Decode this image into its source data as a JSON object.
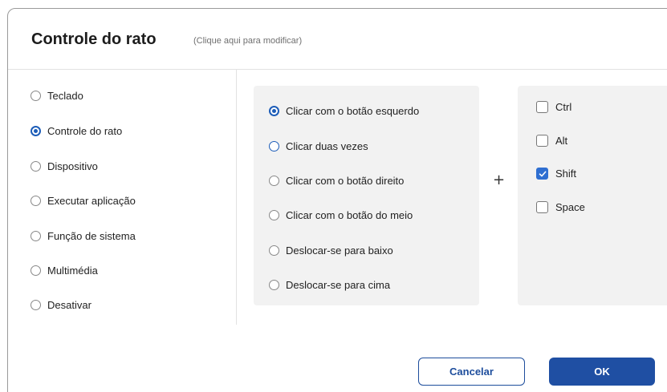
{
  "dialog": {
    "title": "Controle do rato",
    "subtitle": "(Clique aqui para modificar)"
  },
  "categories": [
    {
      "label": "Teclado",
      "selected": false
    },
    {
      "label": "Controle do rato",
      "selected": true
    },
    {
      "label": "Dispositivo",
      "selected": false
    },
    {
      "label": "Executar aplicação",
      "selected": false
    },
    {
      "label": "Função de sistema",
      "selected": false
    },
    {
      "label": "Multimédia",
      "selected": false
    },
    {
      "label": "Desativar",
      "selected": false
    }
  ],
  "mouse_actions": [
    {
      "label": "Clicar com o botão esquerdo",
      "state": "selected"
    },
    {
      "label": "Clicar duas vezes",
      "state": "hover"
    },
    {
      "label": "Clicar com o botão direito",
      "state": "none"
    },
    {
      "label": "Clicar com o botão do meio",
      "state": "none"
    },
    {
      "label": "Deslocar-se para baixo",
      "state": "none"
    },
    {
      "label": "Deslocar-se para cima",
      "state": "none"
    }
  ],
  "plus_symbol": "+",
  "modifiers": [
    {
      "label": "Ctrl",
      "checked": false
    },
    {
      "label": "Alt",
      "checked": false
    },
    {
      "label": "Shift",
      "checked": true
    },
    {
      "label": "Space",
      "checked": false
    }
  ],
  "buttons": {
    "cancel": "Cancelar",
    "ok": "OK"
  },
  "colors": {
    "accent": "#1d5db8",
    "primary_button": "#1f4fa3",
    "panel_bg": "#f2f2f2"
  }
}
